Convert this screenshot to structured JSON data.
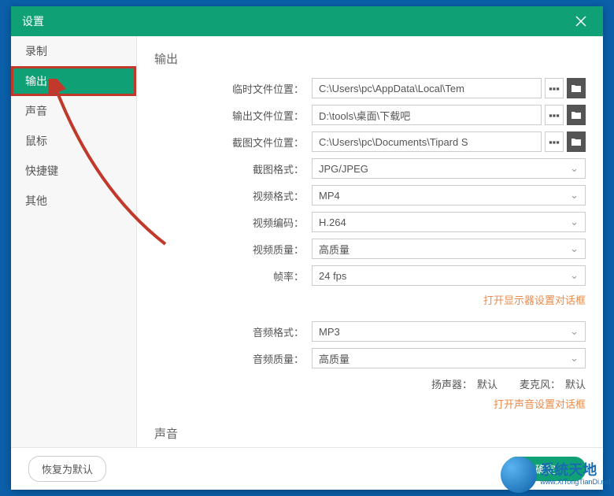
{
  "titlebar": {
    "title": "设置"
  },
  "sidebar": {
    "items": [
      {
        "label": "录制"
      },
      {
        "label": "输出"
      },
      {
        "label": "声音"
      },
      {
        "label": "鼠标"
      },
      {
        "label": "快捷键"
      },
      {
        "label": "其他"
      }
    ]
  },
  "main": {
    "section_output": "输出",
    "temp_path_label": "临时文件位置：",
    "temp_path_value": "C:\\Users\\pc\\AppData\\Local\\Tem",
    "out_path_label": "输出文件位置：",
    "out_path_value": "D:\\tools\\桌面\\下载吧",
    "shot_path_label": "截图文件位置：",
    "shot_path_value": "C:\\Users\\pc\\Documents\\Tipard S",
    "shot_fmt_label": "截图格式：",
    "shot_fmt_value": "JPG/JPEG",
    "vid_fmt_label": "视频格式：",
    "vid_fmt_value": "MP4",
    "vid_enc_label": "视频编码：",
    "vid_enc_value": "H.264",
    "vid_q_label": "视频质量：",
    "vid_q_value": "高质量",
    "fps_label": "帧率：",
    "fps_value": "24 fps",
    "display_link": "打开显示器设置对话框",
    "aud_fmt_label": "音频格式：",
    "aud_fmt_value": "MP3",
    "aud_q_label": "音频质量：",
    "aud_q_value": "高质量",
    "speaker_label": "扬声器：",
    "speaker_value": "默认",
    "mic_label": "麦克风：",
    "mic_value": "默认",
    "sound_link": "打开声音设置对话框",
    "section_sound": "声音",
    "more_btn": "▪▪▪"
  },
  "footer": {
    "reset": "恢复为默认",
    "ok": "确定"
  },
  "watermark": {
    "cn": "系统天地",
    "en": "www.XiTongTianDi.net"
  }
}
